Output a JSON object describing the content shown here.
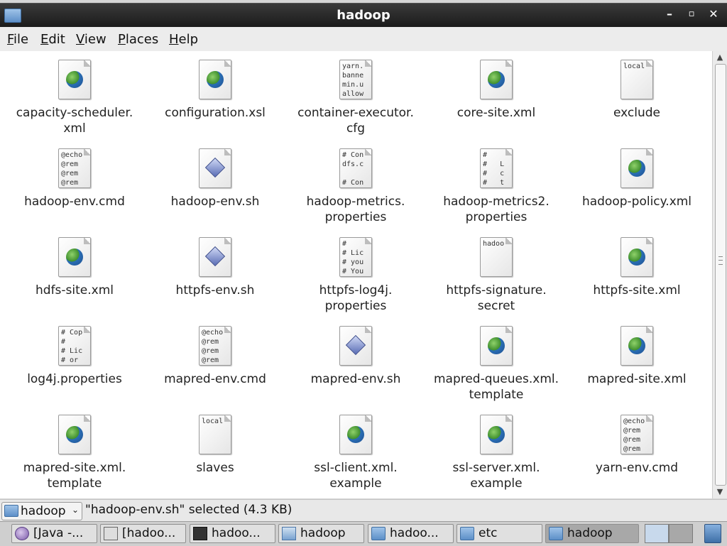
{
  "window": {
    "title": "hadoop",
    "buttons": {
      "minimize": "–",
      "maximize": "▫",
      "close": "✕"
    }
  },
  "menubar": {
    "items": [
      {
        "label": "File",
        "mnemonic": "F",
        "rest": "ile"
      },
      {
        "label": "Edit",
        "mnemonic": "E",
        "rest": "dit"
      },
      {
        "label": "View",
        "mnemonic": "V",
        "rest": "iew"
      },
      {
        "label": "Places",
        "mnemonic": "P",
        "rest": "laces"
      },
      {
        "label": "Help",
        "mnemonic": "H",
        "rest": "elp"
      }
    ]
  },
  "files": [
    {
      "name": "capacity-scheduler.\nxml",
      "icon": "globe"
    },
    {
      "name": "configuration.xsl",
      "icon": "globe"
    },
    {
      "name": "container-executor.\ncfg",
      "icon": "text",
      "preview": "yarn.\nbanne\nmin.u\nallow"
    },
    {
      "name": "core-site.xml",
      "icon": "globe"
    },
    {
      "name": "exclude",
      "icon": "text",
      "preview": "local"
    },
    {
      "name": "hadoop-env.cmd",
      "icon": "text",
      "preview": "@echo\n@rem\n@rem\n@rem"
    },
    {
      "name": "hadoop-env.sh",
      "icon": "script"
    },
    {
      "name": "hadoop-metrics.\nproperties",
      "icon": "text",
      "preview": "# Con\ndfs.c\n\n# Con"
    },
    {
      "name": "hadoop-metrics2.\nproperties",
      "icon": "text",
      "preview": "#\n#   L\n#   c\n#   t"
    },
    {
      "name": "hadoop-policy.xml",
      "icon": "globe"
    },
    {
      "name": "hdfs-site.xml",
      "icon": "globe"
    },
    {
      "name": "httpfs-env.sh",
      "icon": "script"
    },
    {
      "name": "httpfs-log4j.\nproperties",
      "icon": "text",
      "preview": "#\n# Lic\n# you\n# You"
    },
    {
      "name": "httpfs-signature.\nsecret",
      "icon": "text",
      "preview": "hadoo"
    },
    {
      "name": "httpfs-site.xml",
      "icon": "globe"
    },
    {
      "name": "log4j.properties",
      "icon": "text",
      "preview": "# Cop\n#\n# Lic\n# or"
    },
    {
      "name": "mapred-env.cmd",
      "icon": "text",
      "preview": "@echo\n@rem\n@rem\n@rem"
    },
    {
      "name": "mapred-env.sh",
      "icon": "script"
    },
    {
      "name": "mapred-queues.xml.\ntemplate",
      "icon": "globe"
    },
    {
      "name": "mapred-site.xml",
      "icon": "globe"
    },
    {
      "name": "mapred-site.xml.\ntemplate",
      "icon": "globe"
    },
    {
      "name": "slaves",
      "icon": "text",
      "preview": "local"
    },
    {
      "name": "ssl-client.xml.\nexample",
      "icon": "globe"
    },
    {
      "name": "ssl-server.xml.\nexample",
      "icon": "globe"
    },
    {
      "name": "yarn-env.cmd",
      "icon": "text",
      "preview": "@echo\n@rem\n@rem\n@rem"
    }
  ],
  "statusbar": {
    "location": "hadoop",
    "status": "\"hadoop-env.sh\" selected (4.3 KB)"
  },
  "taskbar": {
    "items": [
      {
        "label": "[Java -...",
        "icon": "java-icon"
      },
      {
        "label": "[hadoo...",
        "icon": "frame-icon"
      },
      {
        "label": "hadoo...",
        "icon": "terminal-icon"
      },
      {
        "label": "hadoop",
        "icon": "home-folder-icon"
      },
      {
        "label": "hadoo...",
        "icon": "folder-icon"
      },
      {
        "label": "etc",
        "icon": "folder-icon"
      },
      {
        "label": "hadoop",
        "icon": "folder-icon",
        "active": true
      }
    ]
  }
}
